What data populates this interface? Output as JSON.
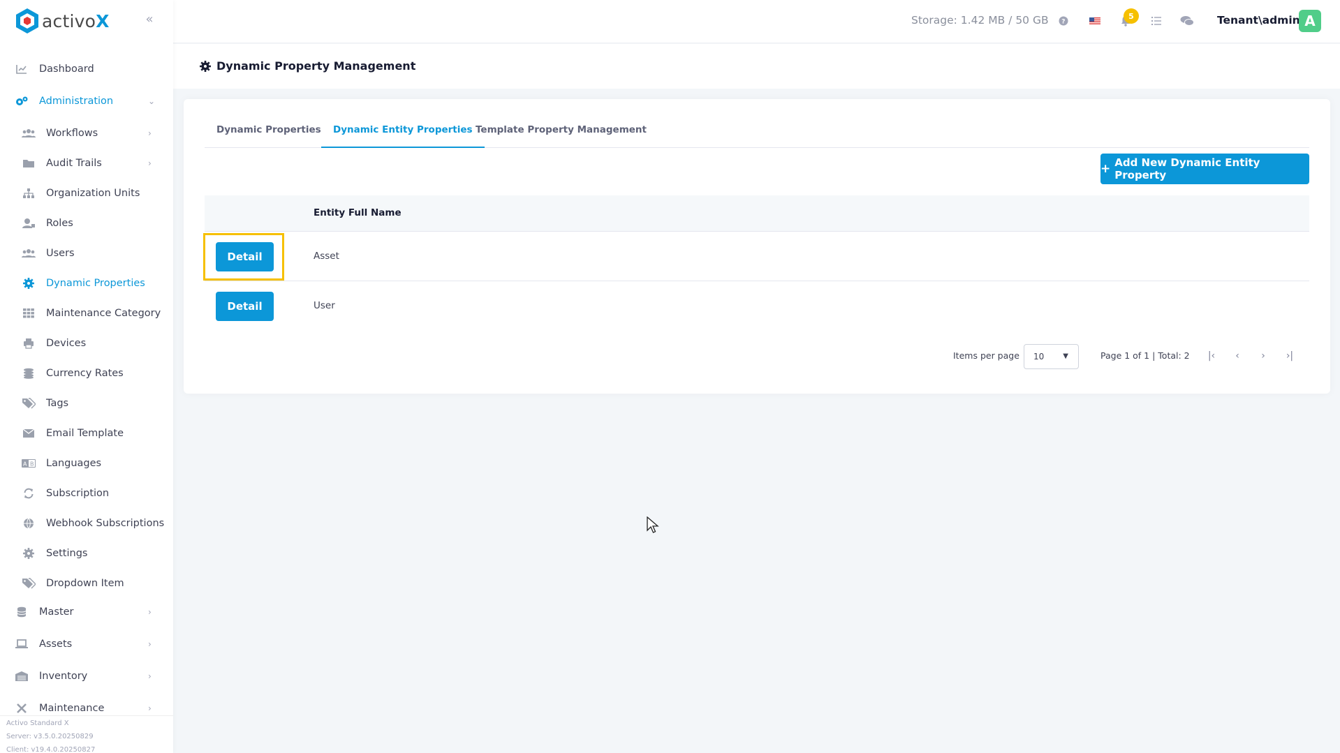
{
  "app": {
    "logo_text_main": "activo",
    "logo_text_x": "X"
  },
  "header": {
    "storage": "Storage: 1.42 MB / 50 GB",
    "notification_count": "5",
    "user": "Tenant\\admin",
    "avatar_letter": "A"
  },
  "sidebar": {
    "items": [
      {
        "label": "Dashboard"
      },
      {
        "label": "Administration"
      },
      {
        "label": "Workflows"
      },
      {
        "label": "Audit Trails"
      },
      {
        "label": "Organization Units"
      },
      {
        "label": "Roles"
      },
      {
        "label": "Users"
      },
      {
        "label": "Dynamic Properties"
      },
      {
        "label": "Maintenance Category"
      },
      {
        "label": "Devices"
      },
      {
        "label": "Currency Rates"
      },
      {
        "label": "Tags"
      },
      {
        "label": "Email Template"
      },
      {
        "label": "Languages"
      },
      {
        "label": "Subscription"
      },
      {
        "label": "Webhook Subscriptions"
      },
      {
        "label": "Settings"
      },
      {
        "label": "Dropdown Item"
      },
      {
        "label": "Master"
      },
      {
        "label": "Assets"
      },
      {
        "label": "Inventory"
      },
      {
        "label": "Maintenance"
      }
    ],
    "version": {
      "product": "Activo Standard X",
      "server": "Server: v3.5.0.20250829",
      "client": "Client: v19.4.0.20250827"
    }
  },
  "page": {
    "title": "Dynamic Property Management"
  },
  "tabs": [
    {
      "label": "Dynamic Properties"
    },
    {
      "label": "Dynamic Entity Properties"
    },
    {
      "label": "Template Property Management"
    }
  ],
  "actions": {
    "add_label": "Add New Dynamic Entity Property"
  },
  "table": {
    "columns": [
      "",
      "Entity Full Name"
    ],
    "rows": [
      {
        "action": "Detail",
        "entity": "Asset"
      },
      {
        "action": "Detail",
        "entity": "User"
      }
    ]
  },
  "pagination": {
    "items_per_page_label": "Items per page",
    "items_per_page": "10",
    "info": "Page 1 of 1 | Total: 2"
  },
  "colors": {
    "accent": "#0c97d8",
    "highlight": "#f6c000",
    "avatar": "#50cd89"
  }
}
